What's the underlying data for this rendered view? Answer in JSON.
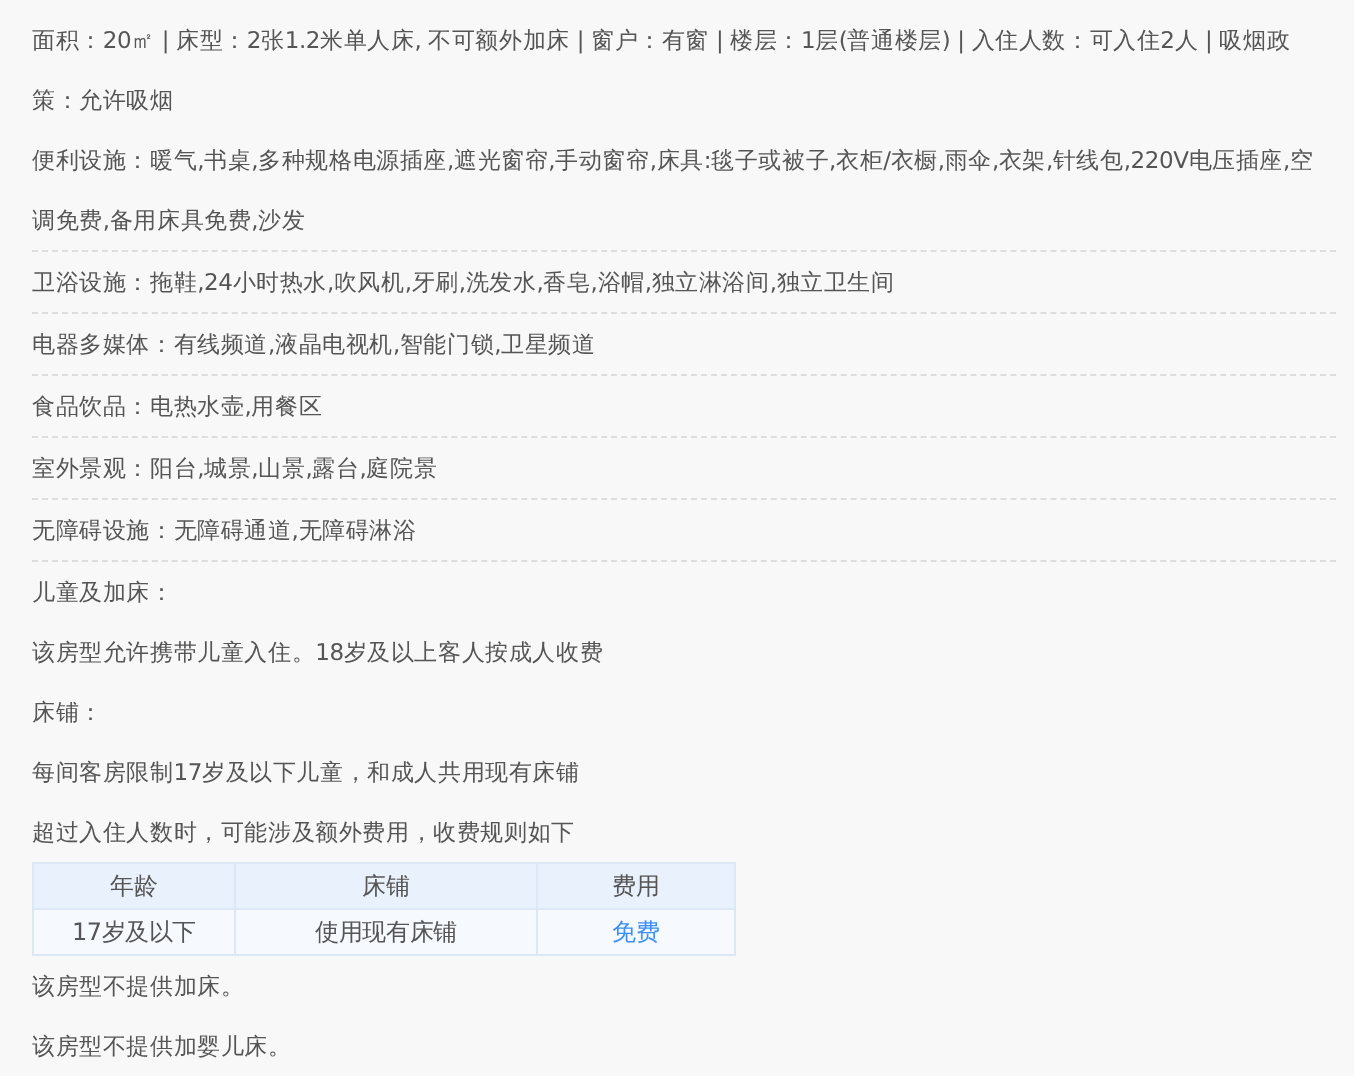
{
  "detail_sections": [
    {
      "lines": [
        "面积：20㎡ | 床型：2张1.2米单人床, 不可额外加床 | 窗户：有窗 | 楼层：1层(普通楼层) | 入住人数：可入住2人 | 吸烟政策：允许吸烟",
        "便利设施：暖气,书桌,多种规格电源插座,遮光窗帘,手动窗帘,床具:毯子或被子,衣柜/衣橱,雨伞,衣架,针线包,220V电压插座,空调免费,备用床具免费,沙发"
      ]
    },
    {
      "lines": [
        "卫浴设施：拖鞋,24小时热水,吹风机,牙刷,洗发水,香皂,浴帽,独立淋浴间,独立卫生间"
      ]
    },
    {
      "lines": [
        "电器多媒体：有线频道,液晶电视机,智能门锁,卫星频道"
      ]
    },
    {
      "lines": [
        "食品饮品：电热水壶,用餐区"
      ]
    },
    {
      "lines": [
        "室外景观：阳台,城景,山景,露台,庭院景"
      ]
    },
    {
      "lines": [
        "无障碍设施：无障碍通道,无障碍淋浴"
      ]
    }
  ],
  "children_policy": {
    "paragraphs_before": [
      "儿童及加床：",
      "该房型允许携带儿童入住。18岁及以上客人按成人收费",
      "床铺：",
      "每间客房限制17岁及以下儿童，和成人共用现有床铺",
      "超过入住人数时，可能涉及额外费用，收费规则如下"
    ],
    "table": {
      "columns": [
        "年龄",
        "床铺",
        "费用"
      ],
      "rows": [
        {
          "cells": [
            {
              "text": "17岁及以下",
              "kind": "text"
            },
            {
              "text": "使用现有床铺",
              "kind": "text"
            },
            {
              "text": "免费",
              "kind": "link"
            }
          ]
        }
      ]
    },
    "paragraphs_after": [
      "该房型不提供加床。",
      "该房型不提供加婴儿床。"
    ]
  }
}
